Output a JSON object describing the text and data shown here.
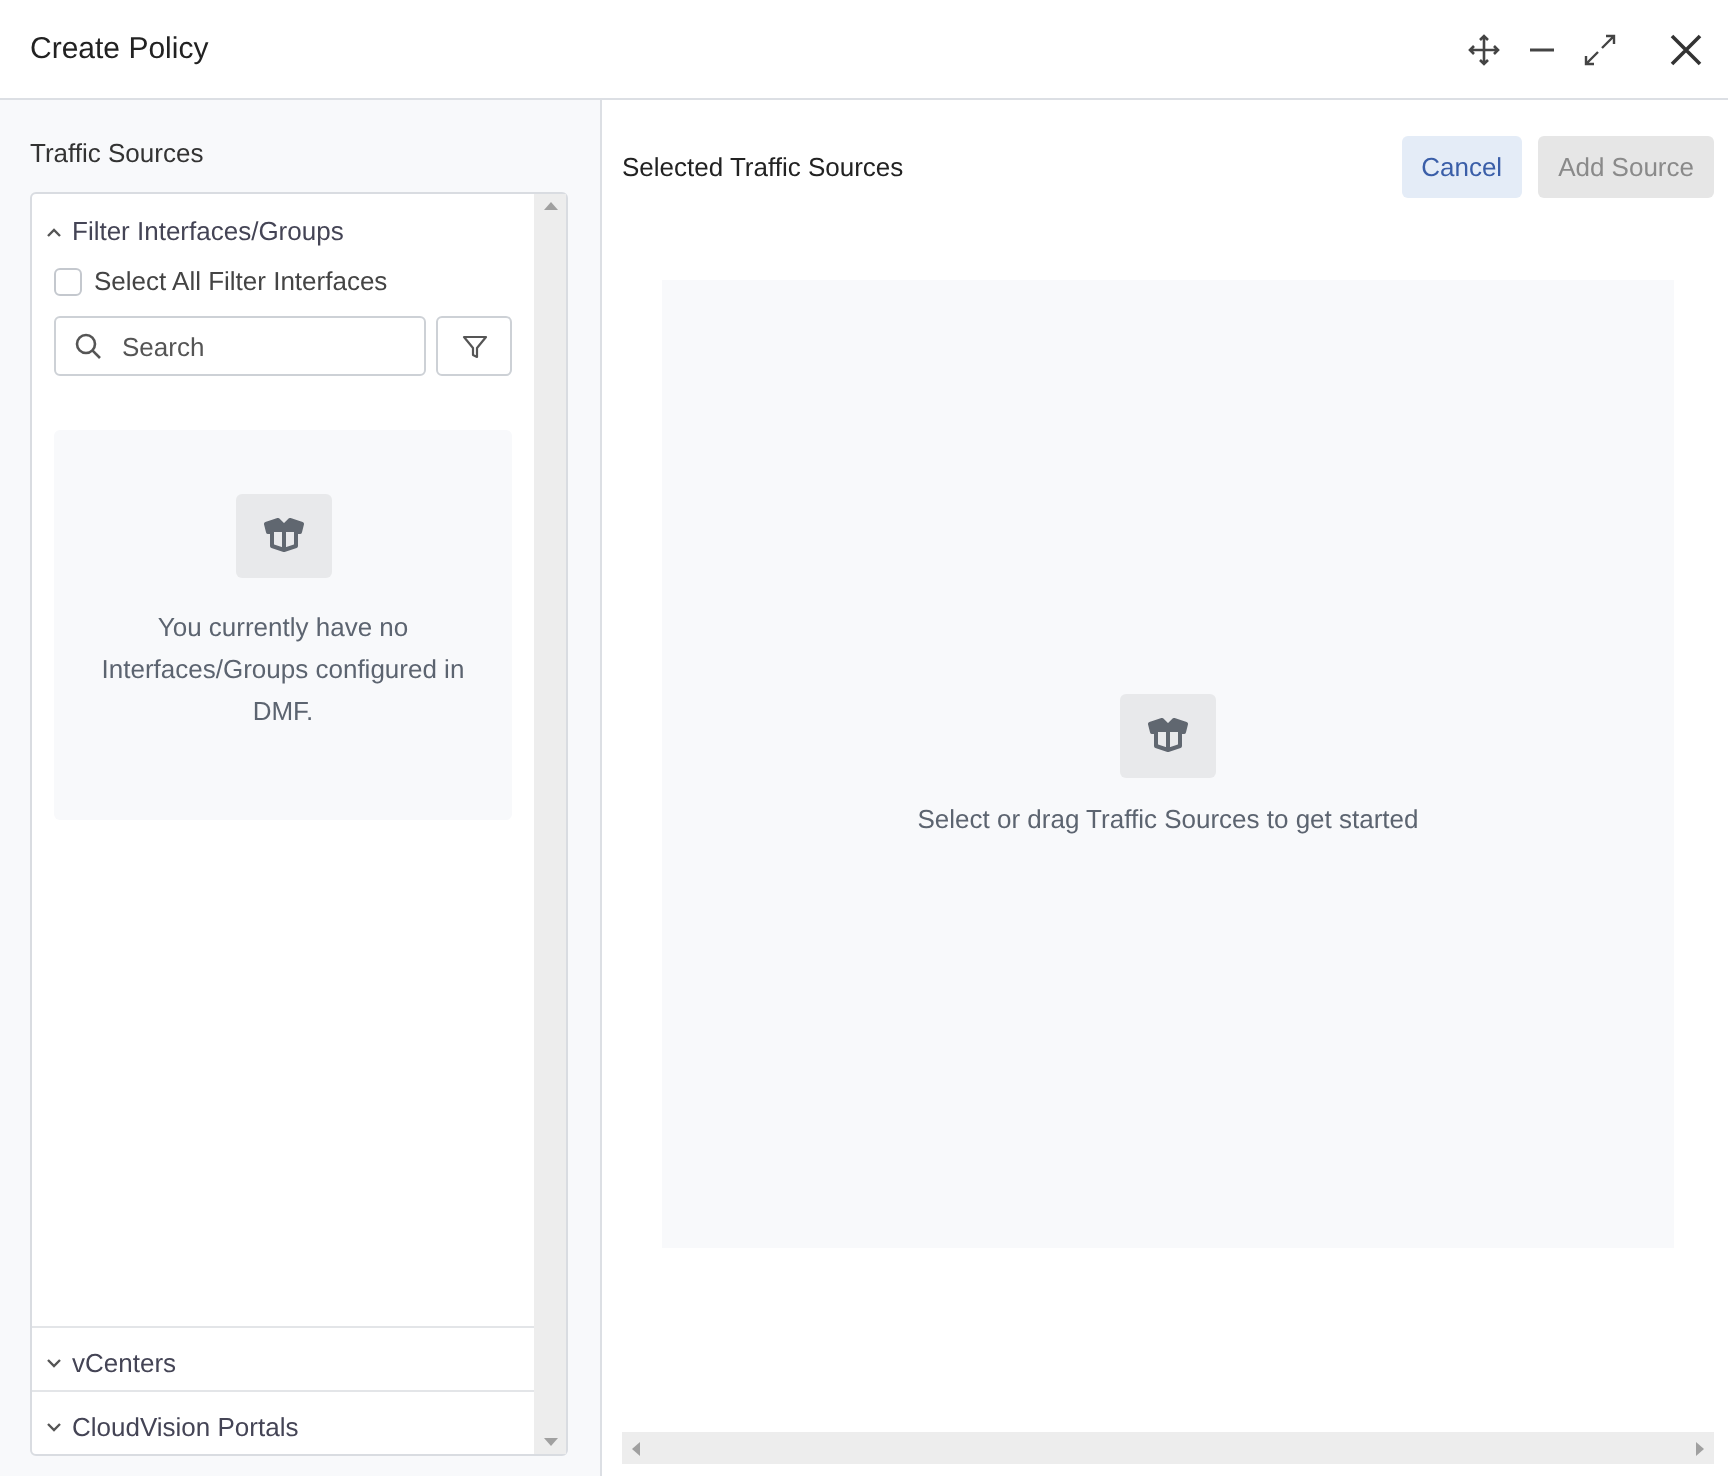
{
  "window": {
    "title": "Create Policy"
  },
  "sources_panel": {
    "title": "Traffic Sources",
    "sections": [
      {
        "label": "Filter Interfaces/Groups",
        "expanded": true,
        "select_all": {
          "label": "Select All Filter Interfaces",
          "checked": false
        },
        "search": {
          "placeholder": "Search"
        },
        "empty_message": "You currently have no Interfaces/Groups configured in DMF."
      },
      {
        "label": "vCenters",
        "expanded": false
      },
      {
        "label": "CloudVision Portals",
        "expanded": false
      }
    ]
  },
  "selected_panel": {
    "title": "Selected Traffic Sources",
    "buttons": [
      {
        "label": "Cancel",
        "kind": "secondary",
        "disabled": false
      },
      {
        "label": "Add Source",
        "kind": "primary",
        "disabled": true
      }
    ],
    "empty_message": "Select or drag Traffic Sources to get started"
  }
}
